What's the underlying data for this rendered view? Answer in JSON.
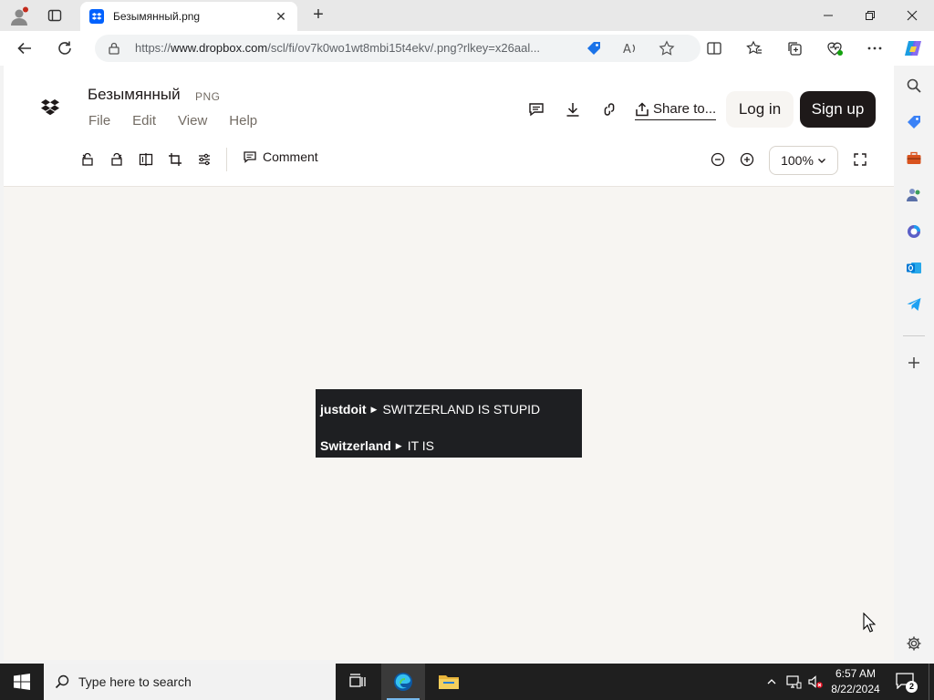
{
  "window": {
    "title": "Безымянный.png",
    "controls": [
      "minimize",
      "maximize",
      "close"
    ]
  },
  "tabs": [
    {
      "title": "Безымянный.png",
      "favicon": "dropbox-icon",
      "active": true
    }
  ],
  "address_bar": {
    "url_prefix": "https://",
    "url_host": "www.dropbox.com",
    "url_path": "/scl/fi/ov7k0wo1wt8mbi15t4ekv/.png?rlkey=x26aal..."
  },
  "dropbox": {
    "file_name": "Безымянный",
    "file_ext": "PNG",
    "menu": [
      "File",
      "Edit",
      "View",
      "Help"
    ],
    "share_label": "Share to...",
    "login_label": "Log in",
    "signup_label": "Sign up",
    "comment_label": "Comment",
    "zoom_label": "100%"
  },
  "image_content": {
    "rows": [
      {
        "user": "justdoit",
        "message": "SWITZERLAND IS STUPID"
      },
      {
        "user": "Switzerland",
        "message": "IT IS"
      }
    ]
  },
  "colors": {
    "dropbox_black": "#1e1919",
    "dropbox_blue": "#0061fe",
    "canvas_bg": "#f7f5f2",
    "image_bg": "#1e1f22",
    "taskbar_bg": "#1f1f1f"
  },
  "taskbar": {
    "search_placeholder": "Type here to search",
    "time": "6:57 AM",
    "date": "8/22/2024",
    "notification_count": "2"
  }
}
